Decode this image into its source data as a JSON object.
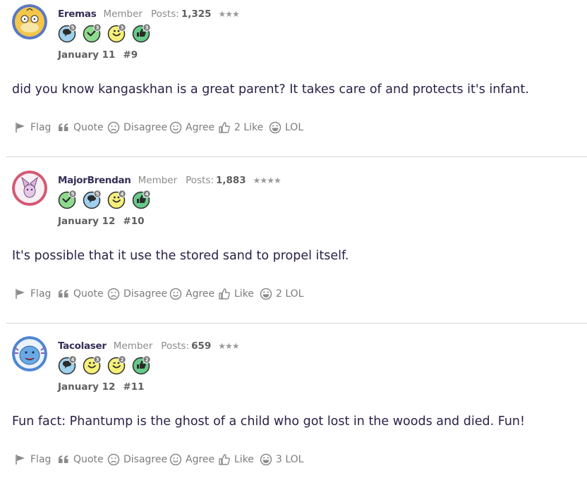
{
  "posts": [
    {
      "username": "Eremas",
      "role": "Member",
      "posts_label": "Posts:",
      "posts_count": "1,325",
      "stars": "★★★",
      "badges": [
        {
          "icon": "speech-bubble-icon",
          "count": "5",
          "color": "#9fd0ef"
        },
        {
          "icon": "checkmark-icon",
          "count": "3",
          "color": "#8edb8f"
        },
        {
          "icon": "smiley-icon",
          "count": "3",
          "color": "#f6f07a"
        },
        {
          "icon": "thumbs-up-icon",
          "count": "3",
          "color": "#68c989"
        }
      ],
      "date": "January 11",
      "post_number": "#9",
      "message": "did you know kangaskhan is a great parent? It takes care of and protects it's infant.",
      "actions": {
        "flag": "Flag",
        "quote": "Quote",
        "disagree": "Disagree",
        "agree": "Agree",
        "like": "2 Like",
        "lol": "LOL"
      }
    },
    {
      "username": "MajorBrendan",
      "role": "Member",
      "posts_label": "Posts:",
      "posts_count": "1,883",
      "stars": "★★★★",
      "badges": [
        {
          "icon": "checkmark-icon",
          "count": "5",
          "color": "#8edb8f"
        },
        {
          "icon": "speech-bubble-icon",
          "count": "5",
          "color": "#9fd0ef"
        },
        {
          "icon": "smiley-icon",
          "count": "4",
          "color": "#f6f07a"
        },
        {
          "icon": "thumbs-up-icon",
          "count": "4",
          "color": "#68c989"
        }
      ],
      "date": "January 12",
      "post_number": "#10",
      "message": "It's possible that it use the stored sand to propel itself.",
      "actions": {
        "flag": "Flag",
        "quote": "Quote",
        "disagree": "Disagree",
        "agree": "Agree",
        "like": "Like",
        "lol": "2 LOL"
      }
    },
    {
      "username": "Tacolaser",
      "role": "Member",
      "posts_label": "Posts:",
      "posts_count": "659",
      "stars": "★★★",
      "badges": [
        {
          "icon": "speech-bubble-icon",
          "count": "4",
          "color": "#9fd0ef"
        },
        {
          "icon": "smiley-icon",
          "count": "3",
          "color": "#f6f07a"
        },
        {
          "icon": "wink-icon",
          "count": "2",
          "color": "#f6f07a"
        },
        {
          "icon": "thumbs-up-icon",
          "count": "2",
          "color": "#68c989"
        }
      ],
      "date": "January 12",
      "post_number": "#11",
      "message": "Fun fact: Phantump is the ghost of a child who got lost in the woods and died. Fun!",
      "actions": {
        "flag": "Flag",
        "quote": "Quote",
        "disagree": "Disagree",
        "agree": "Agree",
        "like": "Like",
        "lol": "3 LOL"
      }
    }
  ],
  "colors": {
    "username": "#352f57",
    "message": "#2c2147",
    "divider": "#d6d6d6",
    "action": "#7c7c7c"
  }
}
